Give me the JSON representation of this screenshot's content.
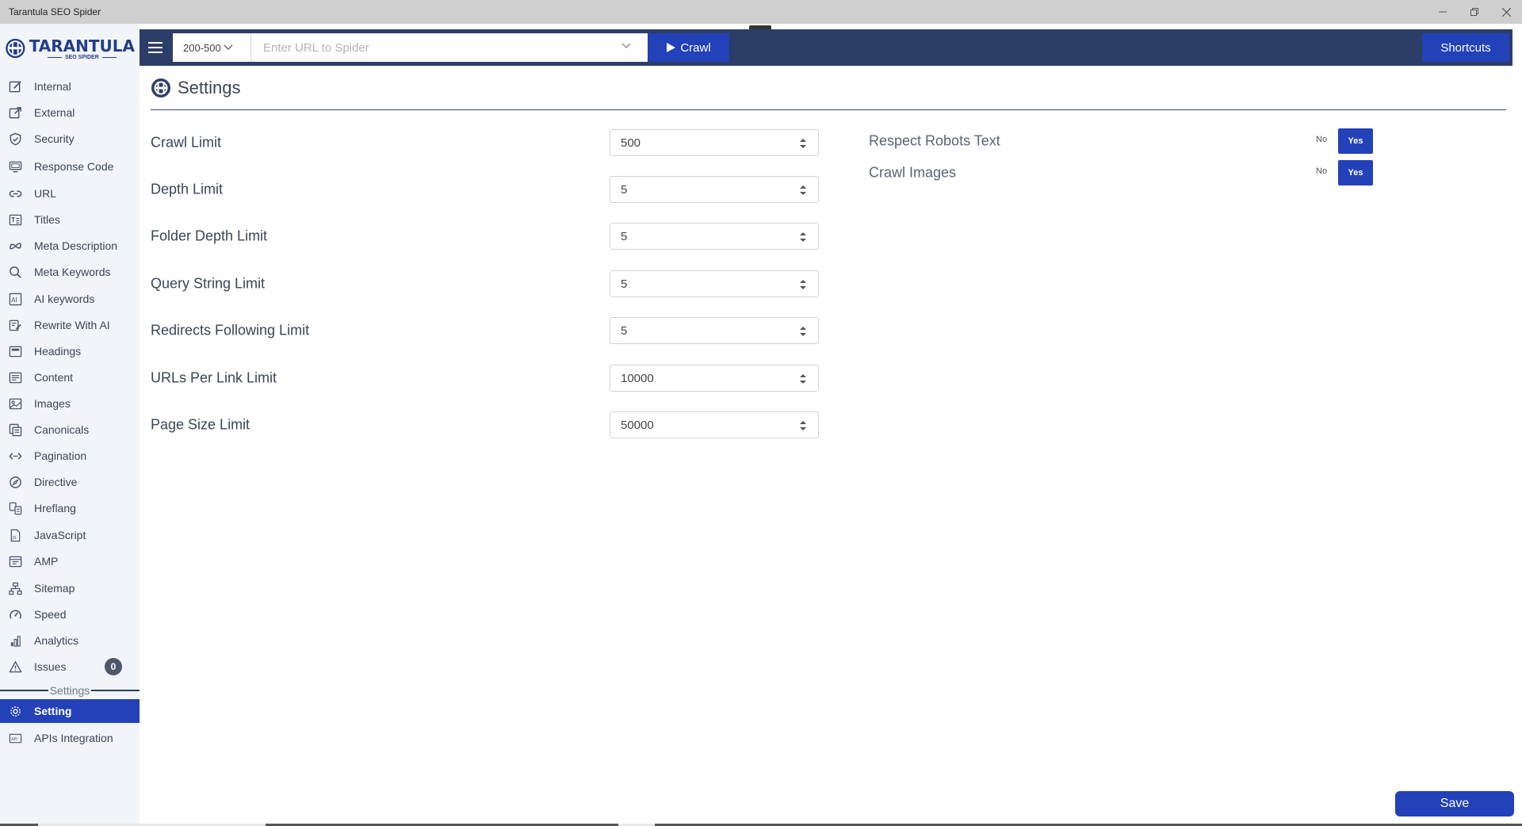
{
  "window": {
    "title": "Tarantula SEO Spider"
  },
  "logo": {
    "name": "TARANTULA",
    "sub": "SEO SPIDER"
  },
  "sidebar": {
    "items": [
      {
        "label": "Internal",
        "icon": "edit-box-icon"
      },
      {
        "label": "External",
        "icon": "external-link-icon"
      },
      {
        "label": "Security",
        "icon": "shield-check-icon"
      },
      {
        "label": "Response Code",
        "icon": "response-code-icon"
      },
      {
        "label": "URL",
        "icon": "link-icon"
      },
      {
        "label": "Titles",
        "icon": "titles-icon"
      },
      {
        "label": "Meta Description",
        "icon": "meta-icon"
      },
      {
        "label": "Meta Keywords",
        "icon": "search-icon"
      },
      {
        "label": "AI keywords",
        "icon": "ai-icon"
      },
      {
        "label": "Rewrite With AI",
        "icon": "rewrite-icon"
      },
      {
        "label": "Headings",
        "icon": "headings-icon"
      },
      {
        "label": "Content",
        "icon": "content-icon"
      },
      {
        "label": "Images",
        "icon": "image-icon"
      },
      {
        "label": "Canonicals",
        "icon": "canonicals-icon"
      },
      {
        "label": "Pagination",
        "icon": "code-brackets-icon"
      },
      {
        "label": "Directive",
        "icon": "compass-icon"
      },
      {
        "label": "Hreflang",
        "icon": "hreflang-icon"
      },
      {
        "label": "JavaScript",
        "icon": "javascript-file-icon"
      },
      {
        "label": "AMP",
        "icon": "amp-icon"
      },
      {
        "label": "Sitemap",
        "icon": "sitemap-icon"
      },
      {
        "label": "Speed",
        "icon": "speedometer-icon"
      },
      {
        "label": "Analytics",
        "icon": "analytics-icon"
      },
      {
        "label": "Issues",
        "icon": "warning-icon",
        "badge": "0"
      }
    ],
    "section_label": "Settings",
    "settings_items": [
      {
        "label": "Setting",
        "icon": "gear-icon",
        "active": true
      },
      {
        "label": "APIs Integration",
        "icon": "api-icon"
      }
    ]
  },
  "toolbar": {
    "status_filter": "200-500",
    "url_placeholder": "Enter URL to Spider",
    "crawl_label": "Crawl",
    "shortcuts_label": "Shortcuts"
  },
  "page": {
    "title": "Settings"
  },
  "limits": [
    {
      "label": "Crawl Limit",
      "value": "500"
    },
    {
      "label": "Depth Limit",
      "value": "5"
    },
    {
      "label": "Folder Depth Limit",
      "value": "5"
    },
    {
      "label": "Query String Limit",
      "value": "5"
    },
    {
      "label": "Redirects Following Limit",
      "value": "5"
    },
    {
      "label": "URLs Per Link Limit",
      "value": "10000"
    },
    {
      "label": "Page Size Limit",
      "value": "50000"
    }
  ],
  "toggles": [
    {
      "label": "Respect Robots Text",
      "no": "No",
      "yes": "Yes",
      "selected": "Yes"
    },
    {
      "label": "Crawl Images",
      "no": "No",
      "yes": "Yes",
      "selected": "Yes"
    }
  ],
  "actions": {
    "save_label": "Save"
  },
  "colors": {
    "accent": "#2341b8",
    "toolbar": "#2c3d68",
    "sidebar_bg": "#f1f4f8"
  }
}
